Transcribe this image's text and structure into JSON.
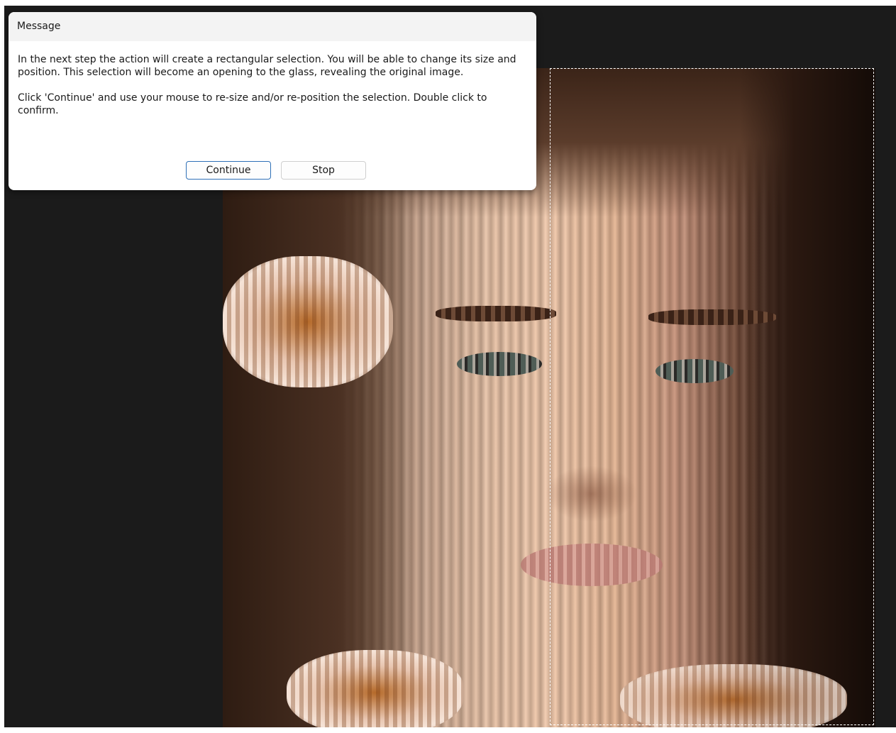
{
  "dialog": {
    "title": "Message",
    "paragraph1": "In the next step the action will create a rectangular selection. You will be able to change its size and position. This selection will become an opening to the glass, revealing the original image.",
    "paragraph2": "Click 'Continue' and use your mouse to re-size and/or re-position the selection. Double click to confirm.",
    "continue_label": "Continue",
    "stop_label": "Stop"
  },
  "canvas": {
    "background_color": "#1b1b1b",
    "selection_border_color": "#ffffff",
    "image_description_icon": "distorted-glass-portrait"
  },
  "colors": {
    "accent": "#2d6fb6",
    "dialog_background": "#ffffff",
    "titlebar_background": "#f3f3f3"
  }
}
